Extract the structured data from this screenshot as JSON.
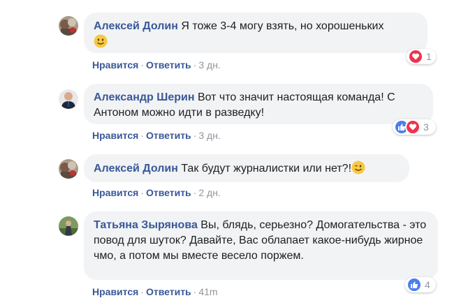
{
  "comments": [
    {
      "author": "Алексей Долин",
      "text": "Я тоже 3-4 могу взять, но хорошеньких",
      "emoji": "slightly-smiling-face",
      "actions": {
        "like": "Нравится",
        "reply": "Ответить",
        "time": "3 дн."
      },
      "reactions": {
        "types": [
          "love"
        ],
        "count": "1"
      }
    },
    {
      "author": "Александр Шерин",
      "text": "Вот что значит настоящая команда! С Антоном можно идти в разведку!",
      "actions": {
        "like": "Нравится",
        "reply": "Ответить",
        "time": "3 дн."
      },
      "reactions": {
        "types": [
          "like",
          "love"
        ],
        "count": "3"
      }
    },
    {
      "author": "Алексей Долин",
      "text": "Так будут журналистки или нет?!",
      "emoji": "winking-face",
      "actions": {
        "like": "Нравится",
        "reply": "Ответить",
        "time": "2 дн."
      }
    },
    {
      "author": "Татьяна Зырянова",
      "text": "Вы, блядь, серьезно? Домогательства - это повод для шуток? Давайте, Вас облапает какое-нибудь жирное чмо, а потом мы вместе весело поржем.",
      "actions": {
        "like": "Нравится",
        "reply": "Ответить",
        "time": "41m"
      },
      "reactions": {
        "types": [
          "like"
        ],
        "count": "4"
      }
    }
  ],
  "colors": {
    "author": "#385898",
    "bubble": "#f2f3f5",
    "like": "#4b7ef0",
    "love": "#f0334f",
    "meta": "#90949c"
  }
}
